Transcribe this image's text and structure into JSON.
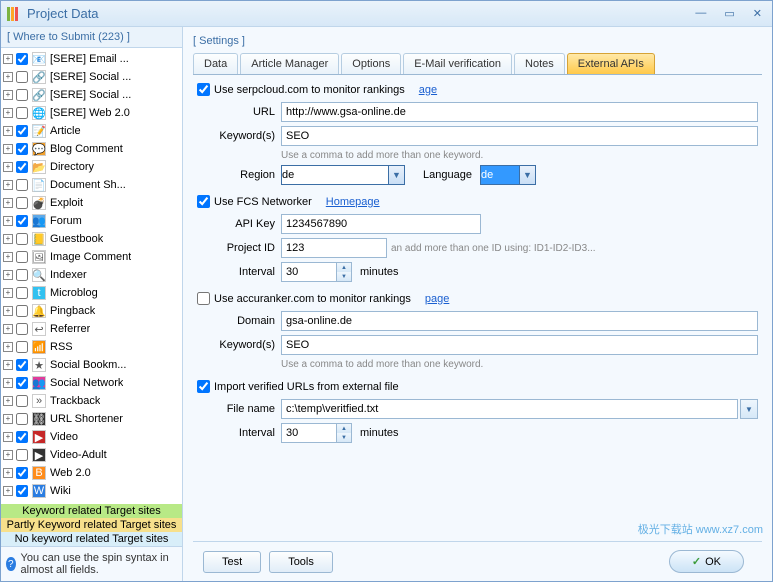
{
  "window": {
    "title": "Project Data"
  },
  "left": {
    "header": "[ Where to Submit  (223) ]",
    "items": [
      {
        "chk": true,
        "icon": "📧",
        "bg": "#fff",
        "label": "[SERE] Email ..."
      },
      {
        "chk": false,
        "icon": "🔗",
        "bg": "#fff",
        "label": "[SERE] Social ..."
      },
      {
        "chk": false,
        "icon": "🔗",
        "bg": "#fff",
        "label": "[SERE] Social ..."
      },
      {
        "chk": false,
        "icon": "🌐",
        "bg": "#fff",
        "label": "[SERE] Web 2.0"
      },
      {
        "chk": true,
        "icon": "📝",
        "bg": "#fff",
        "label": "Article"
      },
      {
        "chk": true,
        "icon": "💬",
        "bg": "#f2a12e",
        "label": "Blog Comment"
      },
      {
        "chk": true,
        "icon": "📂",
        "bg": "#fff",
        "label": "Directory"
      },
      {
        "chk": false,
        "icon": "📄",
        "bg": "#fff",
        "label": "Document Sh..."
      },
      {
        "chk": false,
        "icon": "💣",
        "bg": "#fff",
        "label": "Exploit"
      },
      {
        "chk": true,
        "icon": "👥",
        "bg": "#5fa9e8",
        "label": "Forum"
      },
      {
        "chk": false,
        "icon": "📒",
        "bg": "#fff",
        "label": "Guestbook"
      },
      {
        "chk": false,
        "icon": "🖼",
        "bg": "#fff",
        "label": "Image Comment"
      },
      {
        "chk": false,
        "icon": "🔍",
        "bg": "#fff",
        "label": "Indexer"
      },
      {
        "chk": false,
        "icon": "t",
        "bg": "#32c1f0",
        "label": "Microblog"
      },
      {
        "chk": false,
        "icon": "🔔",
        "bg": "#fff",
        "label": "Pingback"
      },
      {
        "chk": false,
        "icon": "↩",
        "bg": "#fff",
        "label": "Referrer"
      },
      {
        "chk": false,
        "icon": "📶",
        "bg": "#ff8c1a",
        "label": "RSS"
      },
      {
        "chk": true,
        "icon": "★",
        "bg": "#fff",
        "label": "Social Bookm..."
      },
      {
        "chk": true,
        "icon": "👥",
        "bg": "#e33b9a",
        "label": "Social Network"
      },
      {
        "chk": false,
        "icon": "»",
        "bg": "#fff",
        "label": "Trackback"
      },
      {
        "chk": false,
        "icon": "⛓",
        "bg": "#333",
        "label": "URL Shortener"
      },
      {
        "chk": true,
        "icon": "▶",
        "bg": "#c62828",
        "label": "Video"
      },
      {
        "chk": false,
        "icon": "▶",
        "bg": "#333",
        "label": "Video-Adult"
      },
      {
        "chk": true,
        "icon": "B",
        "bg": "#ff8c1a",
        "label": "Web 2.0"
      },
      {
        "chk": true,
        "icon": "W",
        "bg": "#2b7de1",
        "label": "Wiki"
      }
    ],
    "legend1": "Keyword related Target sites",
    "legend2": "Partly Keyword related Target sites",
    "legend3": "No keyword related Target sites",
    "hint": "You can use the spin syntax in almost all fields."
  },
  "settings": {
    "header": "[ Settings ]",
    "tabs": [
      "Data",
      "Article Manager",
      "Options",
      "E-Mail verification",
      "Notes",
      "External APIs"
    ],
    "serpcloud": {
      "label": "Use serpcloud.com to monitor rankings",
      "link": "age",
      "url_label": "URL",
      "url": "http://www.gsa-online.de",
      "kw_label": "Keyword(s)",
      "kw": "SEO",
      "kw_hint": "Use a comma to add more than one keyword.",
      "region_label": "Region",
      "region": "de",
      "lang_label": "Language",
      "lang": "de"
    },
    "fcs": {
      "label": "Use FCS Networker",
      "link": "Homepage",
      "api_label": "API Key",
      "api": "1234567890",
      "pid_label": "Project ID",
      "pid": "123",
      "pid_hint": "an add more than one ID using: ID1-ID2-ID3...",
      "int_label": "Interval",
      "int": "30",
      "int_unit": "minutes"
    },
    "accu": {
      "label": "Use accuranker.com to monitor rankings",
      "link": "page",
      "dom_label": "Domain",
      "dom": "gsa-online.de",
      "kw_label": "Keyword(s)",
      "kw": "SEO",
      "kw_hint": "Use a comma to add more than one keyword."
    },
    "import": {
      "label": "Import verified URLs from external file",
      "fn_label": "File name",
      "fn": "c:\\temp\\veritfied.txt",
      "int_label": "Interval",
      "int": "30",
      "int_unit": "minutes"
    }
  },
  "footer": {
    "test": "Test",
    "tools": "Tools",
    "ok": "OK"
  },
  "watermark": "极光下载站  www.xz7.com"
}
